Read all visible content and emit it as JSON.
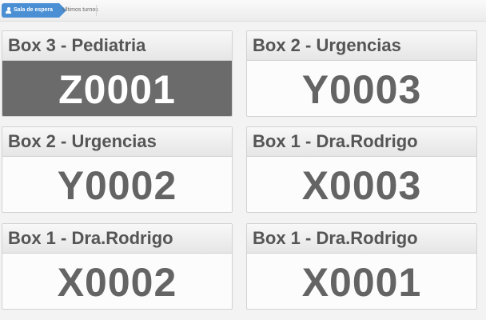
{
  "breadcrumb": {
    "active_label": "Sala de espera",
    "next_label": "Ultimos turnos",
    "active_icon": "user-icon",
    "active_color": "#4a8fd4"
  },
  "turns": [
    {
      "box": "Box 3 - Pediatria",
      "ticket": "Z0001",
      "highlighted": true
    },
    {
      "box": "Box 2 - Urgencias",
      "ticket": "Y0003",
      "highlighted": false
    },
    {
      "box": "Box 2 - Urgencias",
      "ticket": "Y0002",
      "highlighted": false
    },
    {
      "box": "Box 1 - Dra.Rodrigo",
      "ticket": "X0003",
      "highlighted": false
    },
    {
      "box": "Box 1 - Dra.Rodrigo",
      "ticket": "X0002",
      "highlighted": false
    },
    {
      "box": "Box 1 - Dra.Rodrigo",
      "ticket": "X0001",
      "highlighted": false
    }
  ],
  "colors": {
    "highlight_bg": "#6b6b6b",
    "ticket_text": "#646464"
  }
}
